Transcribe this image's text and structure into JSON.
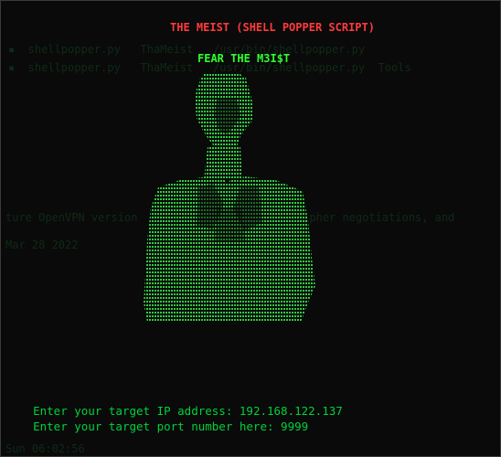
{
  "terminal": {
    "title": "THE MEIST (SHELL POPPER SCRIPT)",
    "subtitle": "FEAR THE M3I$T",
    "prompts": [
      {
        "label": "Enter your target IP address: ",
        "value": "192.168.122.137"
      },
      {
        "label": "Enter your target port number here: ",
        "value": "9999"
      }
    ],
    "colors": {
      "background": "#0a0a0a",
      "title": "#ff3b3b",
      "text": "#00d23a",
      "art": "#2ecc40",
      "ghost": "#0f2a17"
    }
  }
}
